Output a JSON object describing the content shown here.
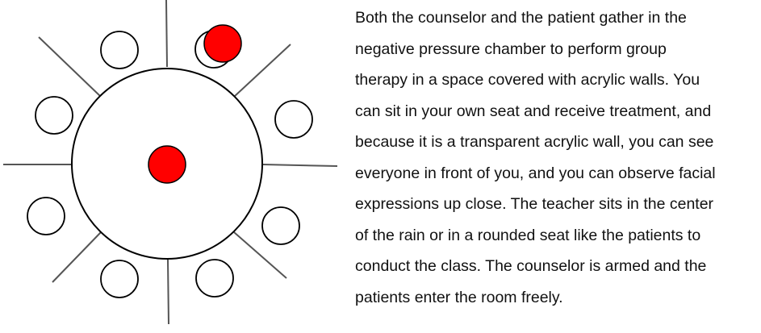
{
  "description": {
    "lines": [
      "Both the counselor and the patient gather in the",
      "negative pressure chamber to perform group",
      "therapy in a space covered with acrylic walls. You",
      "can sit in your own seat and receive treatment, and",
      "because it is a transparent acrylic wall, you can see",
      "everyone in front of you, and you can observe facial",
      "expressions up close. The teacher sits in the center",
      "of the rain or in a rounded seat like the patients to",
      "conduct the class. The counselor is armed and the",
      "patients enter the room freely."
    ]
  },
  "colors": {
    "occupied_seat": "#ff0000",
    "outline": "#000000",
    "partition": "#555555",
    "empty_seat": "#ffffff"
  }
}
